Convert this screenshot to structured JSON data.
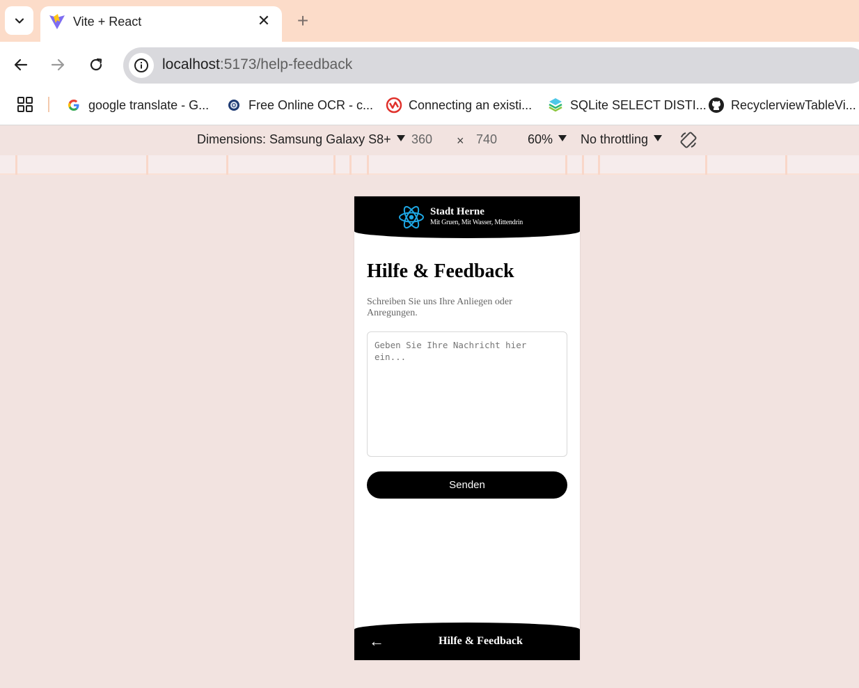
{
  "browser": {
    "tab": {
      "title": "Vite + React"
    },
    "address": {
      "host": "localhost",
      "rest": ":5173/help-feedback"
    },
    "bookmarks": [
      {
        "label": "google translate - G...",
        "icon": "google-icon"
      },
      {
        "label": "Free Online OCR - c...",
        "icon": "ocr-icon"
      },
      {
        "label": "Connecting an existi...",
        "icon": "connect-icon"
      },
      {
        "label": "SQLite SELECT DISTI...",
        "icon": "sqlite-icon"
      },
      {
        "label": "RecyclerviewTableVi...",
        "icon": "github-icon"
      }
    ]
  },
  "devtools": {
    "dimensions_label": "Dimensions: Samsung Galaxy S8+",
    "width": "360",
    "times": "×",
    "height": "740",
    "zoom": "60%",
    "throttling": "No throttling"
  },
  "app": {
    "header": {
      "title": "Stadt Herne",
      "subtitle": "Mit Gruen, Mit Wasser, Mittendrin"
    },
    "page_title": "Hilfe & Feedback",
    "description": "Schreiben Sie uns Ihre Anliegen oder Anregungen.",
    "message_placeholder": "Geben Sie Ihre Nachricht hier ein...",
    "send_label": "Senden",
    "footer": {
      "back": "←",
      "title": "Hilfe & Feedback"
    }
  },
  "colors": {
    "tabstrip": "#fcdcc9",
    "page_bg": "#f2e3e0",
    "app_bar": "#000000",
    "react_logo": "#1ea7e4"
  }
}
